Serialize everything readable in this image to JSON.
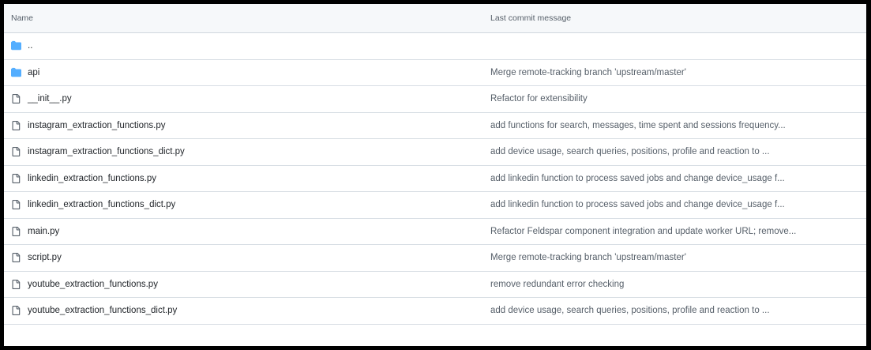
{
  "table": {
    "headers": {
      "name": "Name",
      "commit": "Last commit message"
    },
    "rows": [
      {
        "name": "..",
        "commit": "",
        "icon": "folder-icon"
      },
      {
        "name": "api",
        "commit": "Merge remote-tracking branch 'upstream/master'",
        "icon": "folder-icon"
      },
      {
        "name": "__init__.py",
        "commit": "Refactor for extensibility",
        "icon": "file-icon"
      },
      {
        "name": "instagram_extraction_functions.py",
        "commit": "add functions for search, messages, time spent and sessions frequency...",
        "icon": "file-icon"
      },
      {
        "name": "instagram_extraction_functions_dict.py",
        "commit": "add device usage, search queries, positions, profile and reaction to ...",
        "icon": "file-icon"
      },
      {
        "name": "linkedin_extraction_functions.py",
        "commit": "add linkedin function to process saved jobs and change device_usage f...",
        "icon": "file-icon"
      },
      {
        "name": "linkedin_extraction_functions_dict.py",
        "commit": "add linkedin function to process saved jobs and change device_usage f...",
        "icon": "file-icon"
      },
      {
        "name": "main.py",
        "commit": "Refactor Feldspar component integration and update worker URL; remove...",
        "icon": "file-icon"
      },
      {
        "name": "script.py",
        "commit": "Merge remote-tracking branch 'upstream/master'",
        "icon": "file-icon"
      },
      {
        "name": "youtube_extraction_functions.py",
        "commit": "remove redundant error checking",
        "icon": "file-icon"
      },
      {
        "name": "youtube_extraction_functions_dict.py",
        "commit": "add device usage, search queries, positions, profile and reaction to ...",
        "icon": "file-icon"
      }
    ]
  },
  "colors": {
    "folder": "#54aeff",
    "file_icon": "#57606a",
    "header_bg": "#f6f8fa",
    "border": "#d0d7de",
    "text_primary": "#1f2328",
    "text_secondary": "#57606a"
  }
}
